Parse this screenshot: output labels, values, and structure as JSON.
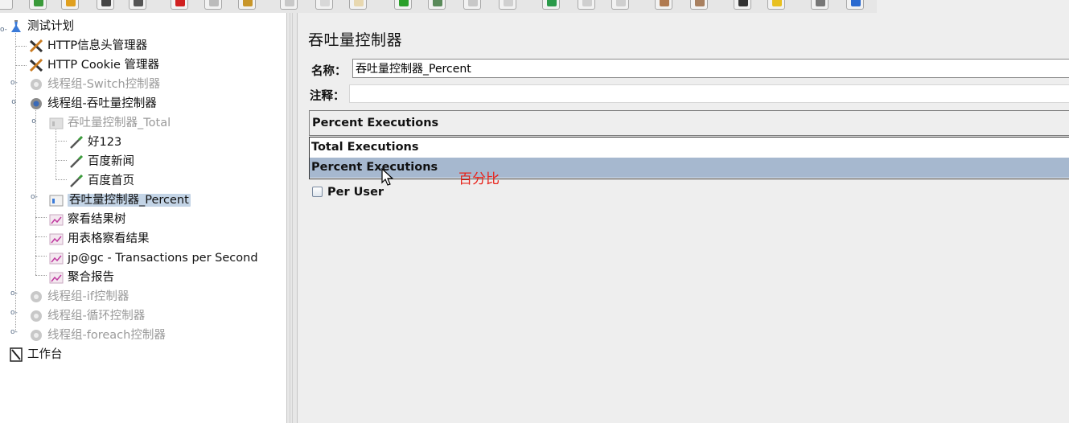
{
  "tree": {
    "nodes": [
      {
        "label": "测试计划",
        "icon": "test-plan-icon",
        "dim": false
      },
      {
        "label": "HTTP信息头管理器",
        "icon": "wrench-icon",
        "dim": false
      },
      {
        "label": "HTTP Cookie 管理器",
        "icon": "wrench-icon",
        "dim": false
      },
      {
        "label": "线程组-Switch控制器",
        "icon": "gear-icon",
        "dim": true
      },
      {
        "label": "线程组-吞吐量控制器",
        "icon": "gear-icon",
        "dim": false
      },
      {
        "label": "吞吐量控制器_Total",
        "icon": "controller-icon",
        "dim": true
      },
      {
        "label": "好123",
        "icon": "sampler-pipette-icon",
        "dim": false
      },
      {
        "label": "百度新闻",
        "icon": "sampler-pipette-icon",
        "dim": false
      },
      {
        "label": "百度首页",
        "icon": "sampler-pipette-icon",
        "dim": false
      },
      {
        "label": "吞吐量控制器_Percent",
        "icon": "controller-icon",
        "dim": false
      },
      {
        "label": "察看结果树",
        "icon": "listener-graph-icon",
        "dim": false
      },
      {
        "label": "用表格察看结果",
        "icon": "listener-graph-icon",
        "dim": false
      },
      {
        "label": "jp@gc - Transactions per Second",
        "icon": "listener-graph-icon",
        "dim": false
      },
      {
        "label": "聚合报告",
        "icon": "listener-graph-icon",
        "dim": false
      },
      {
        "label": "线程组-if控制器",
        "icon": "gear-icon",
        "dim": true
      },
      {
        "label": "线程组-循环控制器",
        "icon": "gear-icon",
        "dim": true
      },
      {
        "label": "线程组-foreach控制器",
        "icon": "gear-icon",
        "dim": true
      },
      {
        "label": "工作台",
        "icon": "workbench-icon",
        "dim": false
      }
    ]
  },
  "panel": {
    "title": "吞吐量控制器",
    "name_label": "名称：",
    "name_value": "吞吐量控制器_Percent",
    "comment_label": "注释：",
    "comment_value": "",
    "mode_selected": "Percent Executions",
    "mode_options": [
      "Total Executions",
      "Percent Executions"
    ],
    "per_user_label": "Per User",
    "per_user_checked": false
  },
  "annotation": "百分比",
  "colors": {
    "selection": "#c3d4e6",
    "dropdown_highlight": "#a6b8cf",
    "annotation": "#e8231b"
  }
}
